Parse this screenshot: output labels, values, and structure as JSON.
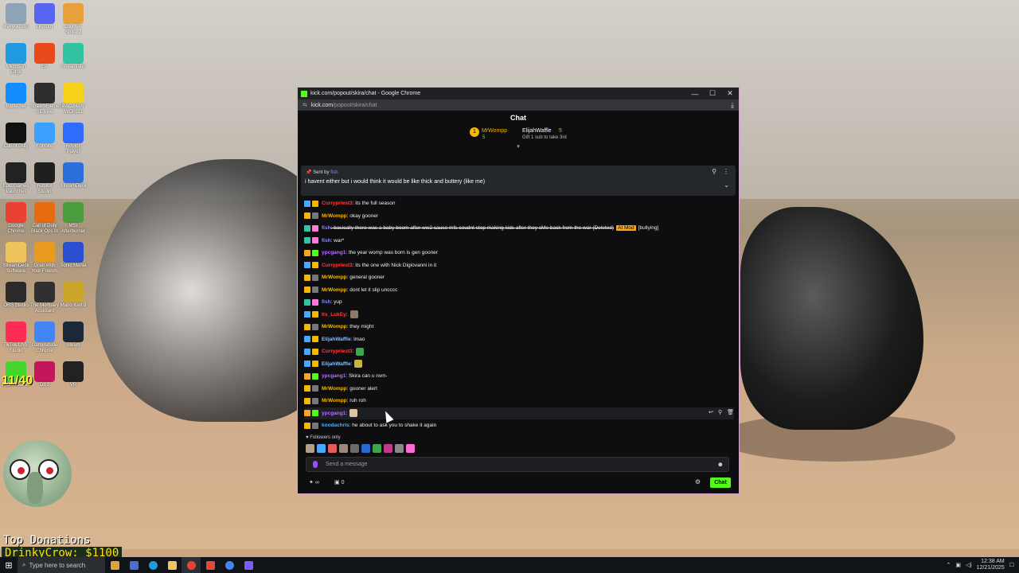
{
  "desktop": {
    "icons": [
      {
        "label": "Recycle Bin",
        "color": "#8fa3b8"
      },
      {
        "label": "Discord",
        "color": "#5865f2"
      },
      {
        "label": "Counter-Strike 2",
        "color": "#e8a13a"
      },
      {
        "label": "Microsoft Edge",
        "color": "#1f9ae0"
      },
      {
        "label": "EA",
        "color": "#e84a1c"
      },
      {
        "label": "Streamlabs",
        "color": "#31c3a2"
      },
      {
        "label": "Battle.net",
        "color": "#148eff"
      },
      {
        "label": "StreamElements SE.Live",
        "color": "#2d2d2d"
      },
      {
        "label": "PAC-MAN WORLD",
        "color": "#f7d21a"
      },
      {
        "label": "Call of Duty",
        "color": "#111111"
      },
      {
        "label": "Fortnite",
        "color": "#3aa0ff"
      },
      {
        "label": "Roblox Player",
        "color": "#2f6bff"
      },
      {
        "label": "Epic Games Launcher",
        "color": "#222222"
      },
      {
        "label": "Roblox Studio",
        "color": "#1f1f1f"
      },
      {
        "label": "StreamDeck",
        "color": "#2c6edb"
      },
      {
        "label": "Google Chrome",
        "color": "#e94235"
      },
      {
        "label": "Call of Duty Black Ops III",
        "color": "#e86b10"
      },
      {
        "label": "MSI Afterburner",
        "color": "#4a9c3c"
      },
      {
        "label": "StreamDeck Software",
        "color": "#f0c45c"
      },
      {
        "label": "Grab With Your Friends",
        "color": "#e99b1f"
      },
      {
        "label": "Sonic Mania",
        "color": "#2b4fd1"
      },
      {
        "label": "OBS Studio",
        "color": "#2a2a2a"
      },
      {
        "label": "The Mortuary Assistant",
        "color": "#303030"
      },
      {
        "label": "Mario Kart 8",
        "color": "#caa62a"
      },
      {
        "label": "TikTok LIVE Studio",
        "color": "#fe2c55"
      },
      {
        "label": "Gamesdude Chrome",
        "color": "#4285f4"
      },
      {
        "label": "Steam",
        "color": "#1b2838"
      },
      {
        "label": "Razer Cortex",
        "color": "#44d62c"
      },
      {
        "label": "OBS",
        "color": "#c2185b"
      },
      {
        "label": "VR",
        "color": "#222222"
      }
    ]
  },
  "overlay": {
    "counter": "11/40",
    "donations_title": "Top Donations",
    "donations_value": "DrinkyCrow: $1100"
  },
  "taskbar": {
    "search_placeholder": "Type here to search",
    "time": "12:38 AM",
    "date": "12/21/2025"
  },
  "window": {
    "title": "kick.com/popout/skira/chat - Google Chrome",
    "url_domain": "kick.com",
    "url_path": "/popout/skira/chat"
  },
  "chat": {
    "header": "Chat",
    "gifters": {
      "first_rank": "1",
      "first_name": "MrWompp",
      "first_count": "5",
      "second_name": "ElijahWaffle",
      "second_count": "5",
      "second_note": "Gift 1 sub to take 3rd"
    },
    "pinned": {
      "sent_by_label": "Sent by",
      "sender": "fish",
      "text": "i havent either but i would think it would be like thick and buttery (like me)"
    },
    "messages": [
      {
        "user": "Currypriest3",
        "text": ": its the full season",
        "color": "#ff3b3b",
        "b1": "#4aa8ff",
        "b2": "#f5b800"
      },
      {
        "user": "MrWompp",
        "text": ": okay gooner",
        "color": "#f5b800",
        "b1": "#f5b800",
        "b2": "#777777"
      },
      {
        "user": "fish",
        "text": ": basically there was a baby boom after ww2 cause mfs coudnt stop making kids after they cMe back from the war (Deleted)",
        "mod_tag": "AI Mod",
        "extra": "[bullying]",
        "color": "#8a8aff",
        "b1": "#31c3a2",
        "b2": "#ff7ad9"
      },
      {
        "user": "fish",
        "text": ": war*",
        "color": "#8a8aff",
        "b1": "#31c3a2",
        "b2": "#ff7ad9"
      },
      {
        "user": "ypcgang1",
        "text": ": the year womp was born is gen gooner",
        "color": "#b76bff",
        "b1": "#f5a623",
        "b2": "#53fc18"
      },
      {
        "user": "Currypriest3",
        "text": ": its the one with Nick Digiovanni in it",
        "color": "#ff3b3b",
        "b1": "#4aa8ff",
        "b2": "#f5b800"
      },
      {
        "user": "MrWompp",
        "text": ": general gooner",
        "color": "#f5b800",
        "b1": "#f5b800",
        "b2": "#777777"
      },
      {
        "user": "MrWompp",
        "text": ": dont let it slip uncccc",
        "color": "#f5b800",
        "b1": "#f5b800",
        "b2": "#777777"
      },
      {
        "user": "fish",
        "text": ": yup",
        "color": "#8a8aff",
        "b1": "#31c3a2",
        "b2": "#ff7ad9"
      },
      {
        "user": "Its_LukEy",
        "text": ":",
        "color": "#ff3b3b",
        "b1": "#4aa8ff",
        "b2": "#f5b800",
        "emote": "#8a7a66"
      },
      {
        "user": "MrWompp",
        "text": ": they might",
        "color": "#f5b800",
        "b1": "#f5b800",
        "b2": "#777777"
      },
      {
        "user": "ElijahWaffle",
        "text": ": lmao",
        "color": "#7fc1ff",
        "b1": "#4aa8ff",
        "b2": "#f5b800"
      },
      {
        "user": "Currypriest3",
        "text": ":",
        "color": "#ff3b3b",
        "b1": "#4aa8ff",
        "b2": "#f5b800",
        "emote": "#3ea64a"
      },
      {
        "user": "ElijahWaffle",
        "text": ":",
        "color": "#7fc1ff",
        "b1": "#4aa8ff",
        "b2": "#f5b800",
        "emote": "#c9b53a"
      },
      {
        "user": "ypcgang1",
        "text": ": Skira can u nvm-",
        "color": "#b76bff",
        "b1": "#f5a623",
        "b2": "#53fc18"
      },
      {
        "user": "MrWompp",
        "text": ": gooner alert",
        "color": "#f5b800",
        "b1": "#f5b800",
        "b2": "#777777"
      },
      {
        "user": "MrWompp",
        "text": ": ruh roh",
        "color": "#f5b800",
        "b1": "#f5b800",
        "b2": "#777777"
      },
      {
        "user": "ypcgang1",
        "text": ":",
        "color": "#b76bff",
        "b1": "#f5a623",
        "b2": "#53fc18",
        "emote": "#e0c3a3",
        "hover": true
      },
      {
        "user": "koodachris",
        "text": ": he about to ask you to shake it again",
        "color": "#38bdf8",
        "b1": "#f5b800",
        "b2": "#777777"
      }
    ],
    "followers_only": "Followers only",
    "emote_bar": [
      "#b4a08a",
      "#4aa8ff",
      "#e85a5a",
      "#9a8a7a",
      "#6a6a6a",
      "#2a6bd1",
      "#3ea64a",
      "#c23b8a",
      "#888888",
      "#ff6ad5"
    ],
    "input_placeholder": "Send a message",
    "points": "∞",
    "bag_count": "0",
    "chat_button": "Chat"
  }
}
